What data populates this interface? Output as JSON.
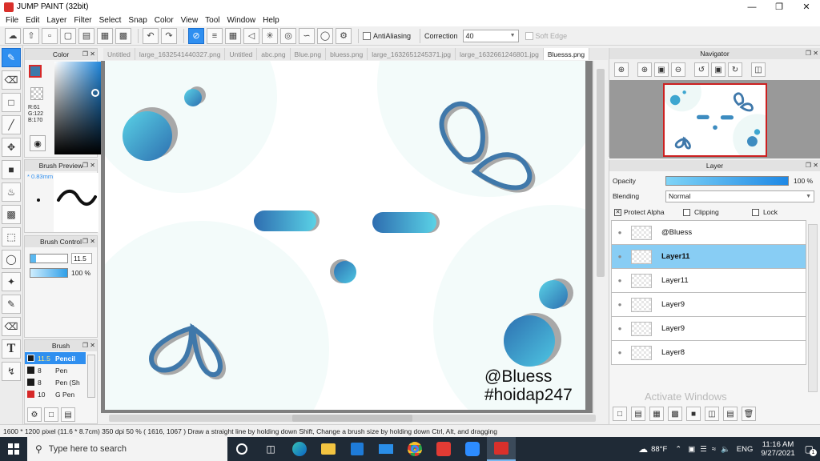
{
  "window": {
    "title": "JUMP PAINT (32bit)"
  },
  "menu": [
    "File",
    "Edit",
    "Layer",
    "Filter",
    "Select",
    "Snap",
    "Color",
    "View",
    "Tool",
    "Window",
    "Help"
  ],
  "toolbar": {
    "antialiasing_label": "AntiAliasing",
    "correction_label": "Correction",
    "correction_value": "40",
    "softedge_label": "Soft Edge"
  },
  "tabs": [
    {
      "label": "Untitled",
      "active": false
    },
    {
      "label": "large_1632541440327.png",
      "active": false
    },
    {
      "label": "Untitled",
      "active": false
    },
    {
      "label": "abc.png",
      "active": false
    },
    {
      "label": "Blue.png",
      "active": false
    },
    {
      "label": "bluess.png",
      "active": false
    },
    {
      "label": "large_1632651245371.jpg",
      "active": false
    },
    {
      "label": "large_1632661246801.jpg",
      "active": false
    },
    {
      "label": "Bluesss.png",
      "active": true
    }
  ],
  "color_panel": {
    "title": "Color",
    "r": "R:61",
    "g": "G:122",
    "b": "B:170",
    "main_color": "#3d7aaa"
  },
  "brush_preview": {
    "title": "Brush Preview",
    "size": "* 0.83mm"
  },
  "brush_control": {
    "title": "Brush Control",
    "size": "11.5",
    "opacity": "100 %"
  },
  "brush_panel": {
    "title": "Brush",
    "items": [
      {
        "size": "11.5",
        "name": "Pencil",
        "color": "#1a1a1a",
        "active": true
      },
      {
        "size": "8",
        "name": "Pen",
        "color": "#1a1a1a",
        "active": false
      },
      {
        "size": "8",
        "name": "Pen (Sh",
        "color": "#1a1a1a",
        "active": false
      },
      {
        "size": "10",
        "name": "G Pen",
        "color": "#d62828",
        "active": false
      }
    ]
  },
  "canvas": {
    "line1": "@Bluess",
    "line2": "#hoidap247"
  },
  "navigator": {
    "title": "Navigator"
  },
  "layer_panel": {
    "title": "Layer",
    "opacity_label": "Opacity",
    "opacity_value": "100 %",
    "opacity_fraction": 1.0,
    "blending_label": "Blending",
    "blending_value": "Normal",
    "protect_alpha": "Protect Alpha",
    "clipping": "Clipping",
    "lock": "Lock",
    "layers": [
      {
        "name": "@Bluess",
        "active": false
      },
      {
        "name": "Layer11",
        "active": true
      },
      {
        "name": "Layer11",
        "active": false
      },
      {
        "name": "Layer9",
        "active": false
      },
      {
        "name": "Layer9",
        "active": false
      },
      {
        "name": "Layer8",
        "active": false
      }
    ],
    "watermark": "Activate Windows"
  },
  "statusbar": {
    "text": "1600 * 1200 pixel  (11.6 * 8.7cm)   350 dpi   50 %   ( 1616, 1067 )   Draw a straight line by holding down Shift, Change a brush size by holding down Ctrl, Alt, and dragging"
  },
  "taskbar": {
    "search_placeholder": "Type here to search",
    "weather": "88°F",
    "lang": "ENG",
    "time": "11:16 AM",
    "date": "9/27/2021",
    "notifications": "1"
  },
  "colors": {
    "accent": "#2f8ff0",
    "layer_active": "#88cdf4",
    "taskbar": "#1f2a36"
  }
}
